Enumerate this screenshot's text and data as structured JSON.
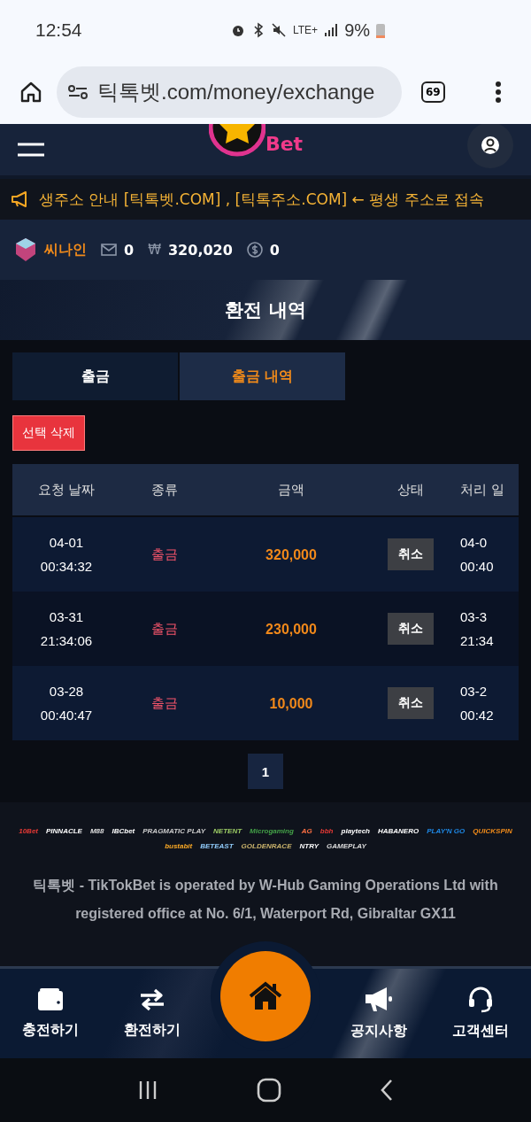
{
  "status_bar": {
    "time": "12:54",
    "network": "LTE+",
    "battery": "9%"
  },
  "address_bar": {
    "url": "틱톡벳.com/money/exchange",
    "tab_count": "69"
  },
  "header": {
    "logo_text": "Bet"
  },
  "notice": {
    "text": "생주소 안내 [틱톡벳.COM] , [틱톡주소.COM] ← 평생 주소로 접속"
  },
  "user": {
    "name": "씨나인",
    "messages": "0",
    "currency": "₩",
    "balance": "320,020",
    "points": "0"
  },
  "page_title": "환전 내역",
  "tabs": [
    {
      "label": "출금",
      "selected": false
    },
    {
      "label": "출금 내역",
      "selected": true
    }
  ],
  "delete_button": "선택 삭제",
  "table": {
    "columns": [
      "요청 날짜",
      "종류",
      "금액",
      "상태",
      "처리 일"
    ],
    "rows": [
      {
        "date": "04-01",
        "time": "00:34:32",
        "type": "출금",
        "amount": "320,000",
        "action": "취소",
        "processed_date": "04-0",
        "processed_time": "00:40"
      },
      {
        "date": "03-31",
        "time": "21:34:06",
        "type": "출금",
        "amount": "230,000",
        "action": "취소",
        "processed_date": "03-3",
        "processed_time": "21:34"
      },
      {
        "date": "03-28",
        "time": "00:40:47",
        "type": "출금",
        "amount": "10,000",
        "action": "취소",
        "processed_date": "03-2",
        "processed_time": "00:42"
      }
    ]
  },
  "pagination": [
    {
      "label": "1",
      "selected": true
    }
  ],
  "providers": [
    {
      "name": "10Bet",
      "color": "#e53935"
    },
    {
      "name": "PINNACLE",
      "color": "#ffffff"
    },
    {
      "name": "M88",
      "color": "#e0e0e0"
    },
    {
      "name": "IBCbet",
      "color": "#ffffff"
    },
    {
      "name": "PRAGMATIC PLAY",
      "color": "#cccccc"
    },
    {
      "name": "NETENT",
      "color": "#9ccc65"
    },
    {
      "name": "Microgaming",
      "color": "#43a047"
    },
    {
      "name": "AG",
      "color": "#ff7043"
    },
    {
      "name": "bbh",
      "color": "#e53935"
    },
    {
      "name": "playtech",
      "color": "#ffffff"
    },
    {
      "name": "HABANERO",
      "color": "#ffffff"
    },
    {
      "name": "PLAY'N GO",
      "color": "#1e88e5"
    },
    {
      "name": "QUICKSPIN",
      "color": "#ef8a1a"
    },
    {
      "name": "bustabit",
      "color": "#f9a825"
    },
    {
      "name": "BETEAST",
      "color": "#90caf9"
    },
    {
      "name": "GOLDENRACE",
      "color": "#c9b26b"
    },
    {
      "name": "NTRY",
      "color": "#ffffff"
    },
    {
      "name": "GAMEPLAY",
      "color": "#dddddd"
    }
  ],
  "footer_text": "틱톡벳 - TikTokBet is operated by W-Hub Gaming Operations Ltd with registered office at No. 6/1, Waterport Rd, Gibraltar GX11",
  "bottom_nav": [
    {
      "label": "충전하기",
      "kind": "wallet"
    },
    {
      "label": "환전하기",
      "kind": "exchange"
    },
    {
      "kind": "home"
    },
    {
      "label": "공지사항",
      "kind": "megaphone"
    },
    {
      "label": "고객센터",
      "kind": "headset"
    }
  ]
}
